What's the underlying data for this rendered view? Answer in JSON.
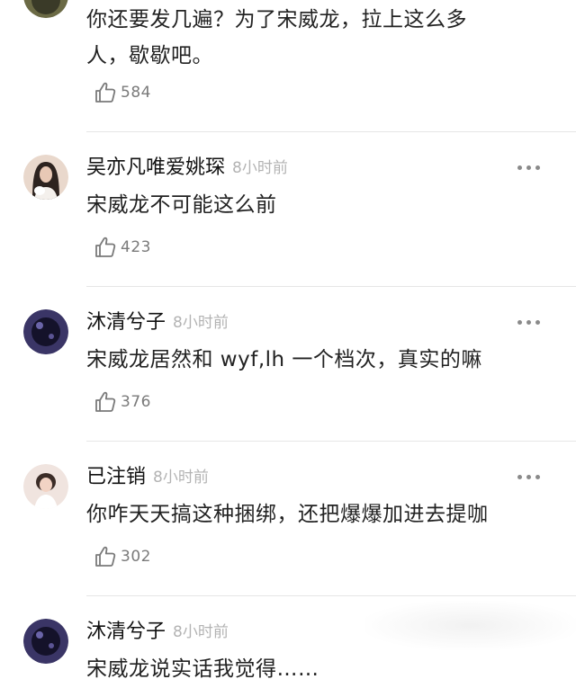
{
  "comments": [
    {
      "username": "",
      "timestamp": "",
      "text_line1": "你还要发几遍？为了宋威龙，拉上这么多",
      "text_line2": "人，歇歇吧。",
      "likes": "584",
      "avatar_colors": [
        "#6b6a45",
        "#3a3a28"
      ]
    },
    {
      "username": "吴亦凡唯爱姚琛",
      "timestamp": "8小时前",
      "text_line1": "宋威龙不可能这么前",
      "likes": "423",
      "avatar_colors": [
        "#e9d8cc",
        "#2d231f"
      ]
    },
    {
      "username": "沐清兮子",
      "timestamp": "8小时前",
      "text_line1": "宋威龙居然和 wyf,lh 一个档次，真实的嘛",
      "likes": "376",
      "avatar_colors": [
        "#3a3566",
        "#14122a"
      ]
    },
    {
      "username": "已注销",
      "timestamp": "8小时前",
      "text_line1": "你咋天天搞这种捆绑，还把爆爆加进去提咖",
      "likes": "302",
      "avatar_colors": [
        "#f0e4df",
        "#3b2c27"
      ]
    },
    {
      "username": "沐清兮子",
      "timestamp": "8小时前",
      "text_line1": "宋威龙说实话我觉得……",
      "likes": "",
      "avatar_colors": [
        "#3a3566",
        "#14122a"
      ]
    }
  ],
  "icons": {
    "like": "thumbs-up-outline-icon",
    "more": "more-horizontal-dots-icon"
  },
  "colors": {
    "text": "#222222",
    "muted": "#b3b3b3",
    "like_count": "#7a7a7a",
    "divider": "#e6e6e6"
  }
}
